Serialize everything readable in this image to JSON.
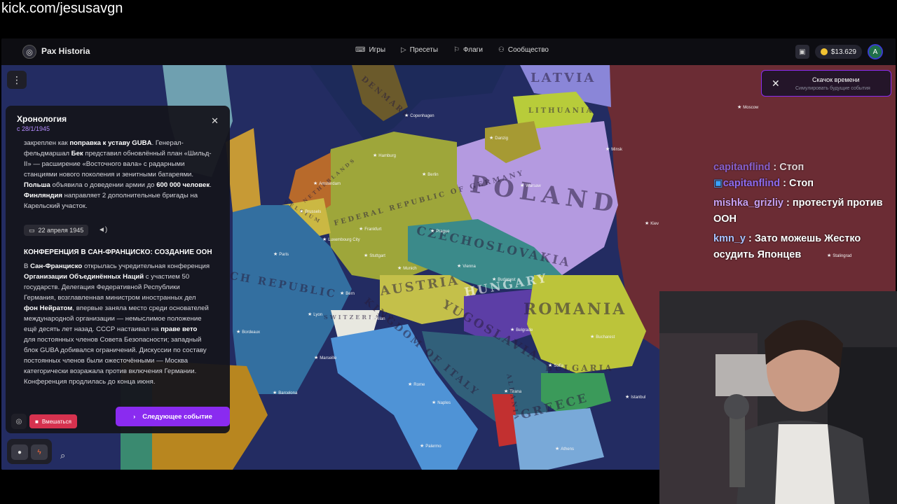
{
  "stream": {
    "url": "kick.com/jesusavgn"
  },
  "app": {
    "title": "Pax Historia",
    "nav": [
      {
        "label": "Игры",
        "icon": "gamepad-icon"
      },
      {
        "label": "Пресеты",
        "icon": "play-icon"
      },
      {
        "label": "Флаги",
        "icon": "flag-icon"
      },
      {
        "label": "Сообщество",
        "icon": "users-icon"
      }
    ],
    "balance": "$13.629",
    "avatar_letter": "A"
  },
  "timeskip": {
    "title": "Скачок времени",
    "subtitle": "Симулировать будущие события"
  },
  "timeline": {
    "title": "Хронология",
    "since": "с 28/1/1945",
    "intro_html_parts": {
      "p1a": "закреплен как ",
      "p1b": "поправка к уставу GUBA",
      "p1c": ". Генерал-фельдмаршал ",
      "p1d": "Бек",
      "p1e": " представил обновлённый план «Шильд-II» — расширение «Восточного вала» с радарными станциями нового поколения и зенитными батареями. ",
      "p1f": "Польша",
      "p1g": " объявила о доведении армии до ",
      "p1h": "600 000 человек",
      "p1i": ". ",
      "p1j": "Финляндия",
      "p1k": " направляет 2 дополнительные бригады на Карельский участок."
    },
    "event_date": "22 апреля 1945",
    "event_title": "КОНФЕРЕНЦИЯ В САН-ФРАНЦИСКО: СОЗДАНИЕ ООН",
    "event_parts": {
      "e1": "В ",
      "e2": "Сан-Франциско",
      "e3": " открылась учредительная конференция ",
      "e4": "Организации Объединённых Наций",
      "e5": " с участием 50 государств. Делегация Федеративной Республики Германия, возглавленная министром иностранных дел ",
      "e6": "фон Нейратом",
      "e7": ", впервые заняла место среди основателей международной организации — немыслимое положение ещё десять лет назад. СССР настаивал на ",
      "e8": "праве вето",
      "e9": " для постоянных членов Совета Безопасности; западный блок GUBA добивался ограничений. Дискуссии по составу постоянных членов были ожесточёнными — Москва категорически возражала против включения Германии. Конференция продлилась до конца июня."
    },
    "intervene_label": "Вмешаться",
    "next_label": "Следующее событие"
  },
  "map": {
    "labels": [
      {
        "text": "LATVIA"
      },
      {
        "text": "LITHUANIA"
      },
      {
        "text": "DENMARK"
      },
      {
        "text": "POLAND"
      },
      {
        "text": "FEDERAL REPUBLIC OF GERMANY"
      },
      {
        "text": "CZECHOSLOVAKIA"
      },
      {
        "text": "AUSTRIA"
      },
      {
        "text": "HUNGARY"
      },
      {
        "text": "ROMANIA"
      },
      {
        "text": "YUGOSLAVIA"
      },
      {
        "text": "KINGDOM OF ITALY"
      },
      {
        "text": "BULGARIA"
      },
      {
        "text": "GREECE"
      },
      {
        "text": "ALBANIA"
      },
      {
        "text": "CH REPUBLIC"
      },
      {
        "text": "BELGIUM"
      },
      {
        "text": "NETHERLANDS"
      },
      {
        "text": "SWITZERLAND"
      }
    ],
    "cities": [
      "Copenhagen",
      "Moscow",
      "Minsk",
      "Kiev",
      "Warsaw",
      "Danzig",
      "Hamburg",
      "Berlin",
      "Amsterdam",
      "Brussels",
      "Paris",
      "Frankfurt",
      "Luxembourg City",
      "Prague",
      "Vienna",
      "Budapest",
      "Munich",
      "Stuttgart",
      "Bern",
      "Lyon",
      "Milan",
      "Bordeaux",
      "Marseille",
      "Barcelona",
      "Rome",
      "Naples",
      "Palermo",
      "Belgrade",
      "Bucharest",
      "Sofia",
      "Tirana",
      "Athens",
      "Istanbul",
      "Stalingrad"
    ]
  },
  "chat": [
    {
      "user": "capitanflind",
      "msg": "Стоп"
    },
    {
      "user": "capitanflind",
      "msg": "Стоп"
    },
    {
      "user": "mishka_grizliy",
      "msg": "протестуй против ООН"
    },
    {
      "user": "kmn_y",
      "msg": "Зато можешь Жестко осудить Японцев"
    }
  ]
}
